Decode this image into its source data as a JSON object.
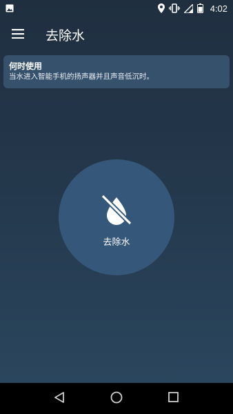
{
  "status_bar": {
    "time": "4:02",
    "icons": [
      "image-notification-icon",
      "location-icon",
      "vibrate-icon",
      "signal-icon",
      "battery-icon"
    ]
  },
  "app_bar": {
    "title": "去除水",
    "menu_icon": "menu-icon"
  },
  "info_card": {
    "title": "何时使用",
    "text": "当水进入智能手机的扬声器并且声音低沉时。"
  },
  "main_button": {
    "label": "去除水",
    "icon": "water-off-icon"
  },
  "nav_bar": {
    "buttons": [
      "back-icon",
      "home-icon",
      "recents-icon"
    ]
  },
  "colors": {
    "background_top": "#1f2f40",
    "background_bottom": "#2b4860",
    "card": "#35516b",
    "button_circle": "#35587a"
  }
}
